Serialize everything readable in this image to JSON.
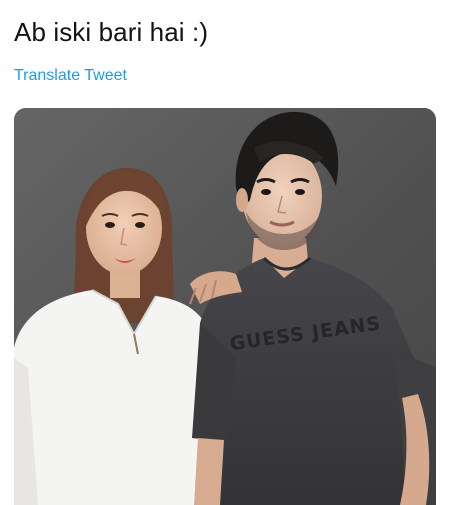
{
  "tweet": {
    "text": "Ab iski bari hai :)",
    "translate_label": "Translate Tweet"
  },
  "media": {
    "shirt_print": "GUESS JEANS",
    "colors": {
      "backdrop": "#5e5e5e",
      "white_top": "#f4f4f2",
      "grey_tshirt": "#3c3c3e",
      "hair_dark": "#1d1a1a",
      "hair_brown": "#6b4330",
      "skin": "#e7c2a8"
    }
  },
  "colors": {
    "text": "#0f1419",
    "link": "#1d9bf0"
  }
}
